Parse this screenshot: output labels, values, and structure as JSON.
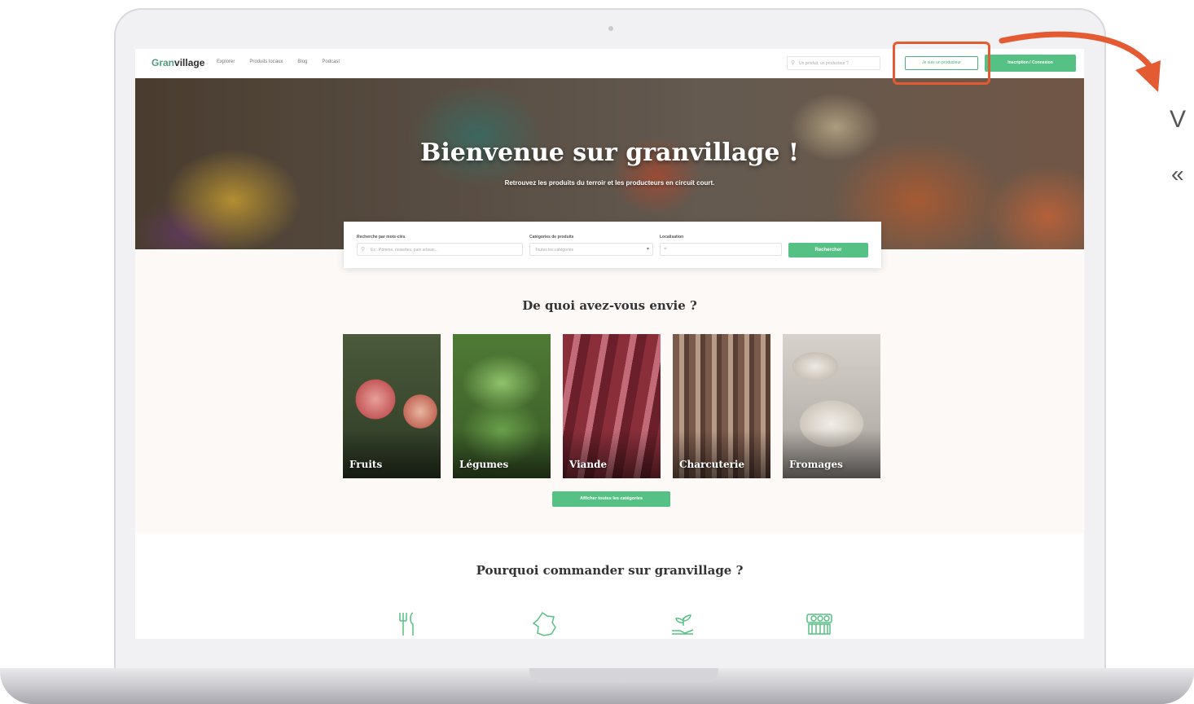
{
  "nav": {
    "logo_accent": "Gran",
    "logo_rest": "village",
    "links": [
      "Explorer",
      "Produits locaux",
      "Blog",
      "Podcast"
    ],
    "search_placeholder": "Un produit, un producteur ?",
    "producer_button": "Je suis un producteur",
    "signup_button": "Inscription / Connexion"
  },
  "hero": {
    "title": "Bienvenue sur granvillage !",
    "subtitle": "Retrouvez les produits du terroir et les producteurs en circuit court."
  },
  "search": {
    "field1_label": "Recherche par mots-clés",
    "field1_placeholder": "Ex : Pomme, noisettes, pain artisan...",
    "field2_label": "Catégories de produits",
    "field2_placeholder": "Toutes les catégories",
    "field3_label": "Localisation",
    "field3_placeholder": "",
    "button": "Rechercher"
  },
  "categories": {
    "heading": "De quoi avez-vous envie ?",
    "items": [
      "Fruits",
      "Légumes",
      "Viande",
      "Charcuterie",
      "Fromages"
    ],
    "all_button": "Afficher toutes les catégories"
  },
  "why": {
    "heading": "Pourquoi commander sur granvillage ?",
    "icons": [
      "cutlery-icon",
      "france-map-icon",
      "plant-hand-icon",
      "market-stall-icon"
    ]
  },
  "annotation": {
    "side_text": "V",
    "side_quote": "«",
    "highlight_color": "#e45a33"
  },
  "colors": {
    "accent": "#56c184",
    "logo_green": "#4f9e7c"
  }
}
